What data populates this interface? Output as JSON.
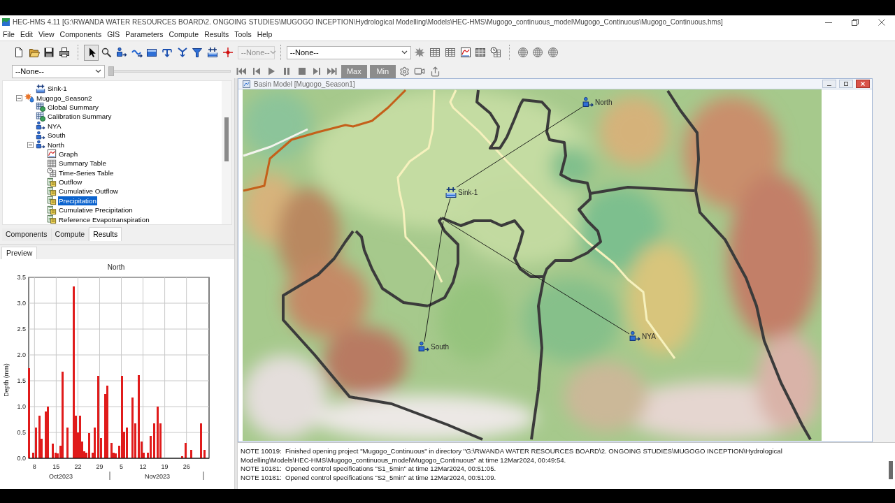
{
  "window": {
    "title": "HEC-HMS 4.11 [G:\\RWANDA WATER RESOURCES BOARD\\2. ONGOING STUDIES\\MUGOGO INCEPTION\\Hydrological Modelling\\Models\\HEC-HMS\\Mugogo_continuous_model\\Mugogo_Continuous\\Mugogo_Continuous.hms]"
  },
  "menu": [
    "File",
    "Edit",
    "View",
    "Components",
    "GIS",
    "Parameters",
    "Compute",
    "Results",
    "Tools",
    "Help"
  ],
  "toolbar": {
    "tools": [
      {
        "selected": true
      },
      {
        "selected": false
      },
      {
        "selected": false
      },
      {
        "selected": false
      },
      {
        "selected": false
      },
      {
        "selected": false
      },
      {
        "selected": false
      },
      {
        "selected": false
      },
      {
        "selected": false
      },
      {
        "selected": false
      }
    ],
    "basin_dropdown": {
      "value": "--None--",
      "disabled": true
    },
    "run_dropdown": {
      "value": "--None--",
      "disabled": false
    },
    "time_dropdown": {
      "value": "--None--",
      "disabled": false
    },
    "time_slider": {
      "level": 0
    },
    "scale_buttons": [
      {
        "label": "Max",
        "disabled": true
      },
      {
        "label": "Min",
        "disabled": true
      }
    ]
  },
  "tree": {
    "items": [
      {
        "children": [
          {
            "label": "Sink-1",
            "kind": "sink",
            "selected": false
          }
        ]
      },
      {
        "label": "Mugogo_Season2",
        "kind": "simulation",
        "selected": false,
        "expanded": true,
        "children": [
          {
            "label": "Global Summary",
            "kind": "summary",
            "selected": false
          },
          {
            "label": "Calibration Summary",
            "kind": "summary",
            "selected": false
          },
          {
            "label": "NYA",
            "kind": "subbasin",
            "selected": false
          },
          {
            "label": "South",
            "kind": "subbasin",
            "selected": false
          },
          {
            "label": "North",
            "kind": "subbasin",
            "selected": false,
            "expanded": true,
            "children": [
              {
                "label": "Graph",
                "kind": "graph",
                "selected": false
              },
              {
                "label": "Summary Table",
                "kind": "table",
                "selected": false
              },
              {
                "label": "Time-Series Table",
                "kind": "time-series-table",
                "selected": false
              },
              {
                "label": "Outflow",
                "kind": "result",
                "selected": false
              },
              {
                "label": "Cumulative Outflow",
                "kind": "result",
                "selected": false
              },
              {
                "label": "Precipitation",
                "kind": "result",
                "selected": true
              },
              {
                "label": "Cumulative Precipitation",
                "kind": "result",
                "selected": false
              },
              {
                "label": "Reference Evapotranspiration",
                "kind": "result",
                "selected": false
              }
            ]
          }
        ]
      }
    ]
  },
  "panel_tabs": [
    {
      "label": "Components",
      "selected": false
    },
    {
      "label": "Compute",
      "selected": false
    },
    {
      "label": "Results",
      "selected": true
    }
  ],
  "preview": {
    "tab": "Preview",
    "chart_data": {
      "type": "bar",
      "title": "North",
      "ylabel": "Depth (mm)",
      "x": [
        "2023-10-06T07:00",
        "2023-10-07T16:00",
        "2023-10-08T10:00",
        "2023-10-09T13:00",
        "2023-10-10T08:00",
        "2023-10-11T14:00",
        "2023-10-12T08:00",
        "2023-10-14T00:00",
        "2023-10-14T17:00",
        "2023-10-15T10:00",
        "2023-10-16T09:00",
        "2023-10-17T04:00",
        "2023-10-18T17:00",
        "2023-10-20T15:00",
        "2023-10-21T07:00",
        "2023-10-22T00:00",
        "2023-10-22T17:00",
        "2023-10-23T10:00",
        "2023-10-24T03:00",
        "2023-10-24T20:00",
        "2023-10-25T13:00",
        "2023-10-26T18:00",
        "2023-10-27T11:00",
        "2023-10-28T12:00",
        "2023-10-29T10:00",
        "2023-10-30T18:00",
        "2023-10-31T12:00",
        "2023-11-01T20:00",
        "2023-11-02T13:00",
        "2023-11-03T07:00",
        "2023-11-04T08:00",
        "2023-11-05T03:00",
        "2023-11-05T20:00",
        "2023-11-06T20:00",
        "2023-11-08T17:00",
        "2023-11-09T12:00",
        "2023-11-10T15:00",
        "2023-11-11T12:00",
        "2023-11-12T06:00",
        "2023-11-13T12:00",
        "2023-11-14T12:00",
        "2023-11-15T15:00",
        "2023-11-16T16:00",
        "2023-11-17T13:00",
        "2023-11-24T17:00",
        "2023-11-25T16:00",
        "2023-11-27T14:00",
        "2023-11-30T18:00",
        "2023-12-01T19:00"
      ],
      "values": [
        1.74,
        0.11,
        0.6,
        0.83,
        0.38,
        0.91,
        1.0,
        0.29,
        0.11,
        0.09,
        0.25,
        1.67,
        0.59,
        3.33,
        0.83,
        0.5,
        0.83,
        0.33,
        0.13,
        0.11,
        0.49,
        0.11,
        0.6,
        1.59,
        0.39,
        1.25,
        1.41,
        0.3,
        0.11,
        0.09,
        0.25,
        1.6,
        0.51,
        0.6,
        1.18,
        0.67,
        1.61,
        0.33,
        0.11,
        0.11,
        0.43,
        0.67,
        1.0,
        0.67,
        0.04,
        0.3,
        0.16,
        0.67,
        0.16
      ],
      "xlim": [
        "2023-10-06T03:00",
        "2023-12-03T07:00"
      ],
      "ylim": [
        0,
        3.5
      ],
      "grid": true,
      "xticks": [
        {
          "value": "2023-10-08",
          "label": "8"
        },
        {
          "value": "2023-10-15",
          "label": "15"
        },
        {
          "value": "2023-10-22",
          "label": "22"
        },
        {
          "value": "2023-10-29",
          "label": "29"
        },
        {
          "value": "2023-11-05",
          "label": "5"
        },
        {
          "value": "2023-11-12",
          "label": "12"
        },
        {
          "value": "2023-11-19",
          "label": "19"
        },
        {
          "value": "2023-11-26",
          "label": "26"
        }
      ],
      "yticks": [
        {
          "value": 0,
          "label": "0.0"
        },
        {
          "value": 0.5,
          "label": "0.5"
        },
        {
          "value": 1,
          "label": "1.0"
        },
        {
          "value": 1.5,
          "label": "1.5"
        },
        {
          "value": 2,
          "label": "2.0"
        },
        {
          "value": 2.5,
          "label": "2.5"
        },
        {
          "value": 3,
          "label": "3.0"
        },
        {
          "value": 3.5,
          "label": "3.5"
        }
      ]
    },
    "period_labels": [
      "Oct2023",
      "Nov2023"
    ]
  },
  "basin_window": {
    "title": "Basin Model [Mugogo_Season1]",
    "elements": [
      {
        "label": "North",
        "kind": "subbasin"
      },
      {
        "label": "Sink-1",
        "kind": "sink"
      },
      {
        "label": "South",
        "kind": "subbasin"
      },
      {
        "label": "NYA",
        "kind": "subbasin"
      }
    ]
  },
  "log": {
    "lines": [
      "NOTE 10019:  Finished opening project \"Mugogo_Continuous\" in directory \"G:\\RWANDA WATER RESOURCES BOARD\\2. ONGOING STUDIES\\MUGOGO INCEPTION\\Hydrological",
      "Modelling\\Models\\HEC-HMS\\Mugogo_continuous_model\\Mugogo_Continuous\" at time 12Mar2024, 00:49:54.",
      "NOTE 10181:  Opened control specifications \"S1_5min\" at time 12Mar2024, 00:51:05.",
      "NOTE 10181:  Opened control specifications \"S2_5min\" at time 12Mar2024, 00:51:09."
    ]
  }
}
